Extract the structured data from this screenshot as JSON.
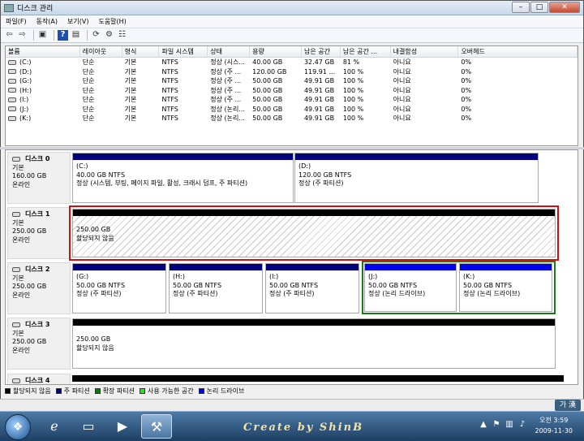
{
  "window": {
    "title": "디스크 관리"
  },
  "menu": [
    "파일(F)",
    "동작(A)",
    "보기(V)",
    "도움말(H)"
  ],
  "toolbar": {
    "icons": [
      "back-icon",
      "forward-icon",
      "console-icon",
      "help-icon",
      "show-hide-icon",
      "refresh-icon",
      "properties-icon",
      "export-icon"
    ],
    "glyphs": [
      "⇦",
      "⇨",
      "▣",
      "?",
      "▤",
      "⟳",
      "⚙",
      "☷"
    ]
  },
  "volume_list": {
    "columns": [
      "볼륨",
      "레이아웃",
      "형식",
      "파일 시스템",
      "상태",
      "용량",
      "남은 공간",
      "남은 공간 ...",
      "내결함성",
      "오버헤드"
    ],
    "rows": [
      [
        "(C:)",
        "단순",
        "기본",
        "NTFS",
        "정상 (시스...",
        "40.00 GB",
        "32.47 GB",
        "81 %",
        "아니요",
        "0%"
      ],
      [
        "(D:)",
        "단순",
        "기본",
        "NTFS",
        "정상 (주 ...",
        "120.00 GB",
        "119.91 ...",
        "100 %",
        "아니요",
        "0%"
      ],
      [
        "(G:)",
        "단순",
        "기본",
        "NTFS",
        "정상 (주 ...",
        "50.00 GB",
        "49.91 GB",
        "100 %",
        "아니요",
        "0%"
      ],
      [
        "(H:)",
        "단순",
        "기본",
        "NTFS",
        "정상 (주 ...",
        "50.00 GB",
        "49.91 GB",
        "100 %",
        "아니요",
        "0%"
      ],
      [
        "(I:)",
        "단순",
        "기본",
        "NTFS",
        "정상 (주 ...",
        "50.00 GB",
        "49.91 GB",
        "100 %",
        "아니요",
        "0%"
      ],
      [
        "(J:)",
        "단순",
        "기본",
        "NTFS",
        "정상 (논리...",
        "50.00 GB",
        "49.91 GB",
        "100 %",
        "아니요",
        "0%"
      ],
      [
        "(K:)",
        "단순",
        "기본",
        "NTFS",
        "정상 (논리...",
        "50.00 GB",
        "49.91 GB",
        "100 %",
        "아니요",
        "0%"
      ]
    ]
  },
  "disks": [
    {
      "name": "디스크 0",
      "type": "기본",
      "size": "160.00 GB",
      "status": "온라인",
      "partitions": [
        {
          "label": "(C:)",
          "size": "40.00 GB NTFS",
          "status": "정상 (시스템, 부팅, 페이지 파일, 활성, 크래시 덤프, 주 파티션)"
        },
        {
          "label": "(D:)",
          "size": "120.00 GB NTFS",
          "status": "정상 (주 파티션)"
        }
      ]
    },
    {
      "name": "디스크 1",
      "type": "기본",
      "size": "250.00 GB",
      "status": "온라인",
      "partitions": [
        {
          "label": "250.00 GB",
          "size": "할당되지 않음"
        }
      ]
    },
    {
      "name": "디스크 2",
      "type": "기본",
      "size": "250.00 GB",
      "status": "온라인",
      "partitions": [
        {
          "label": "(G:)",
          "size": "50.00 GB NTFS",
          "status": "정상 (주 파티션)"
        },
        {
          "label": "(H:)",
          "size": "50.00 GB NTFS",
          "status": "정상 (주 파티션)"
        },
        {
          "label": "(I:)",
          "size": "50.00 GB NTFS",
          "status": "정상 (주 파티션)"
        },
        {
          "label": "(J:)",
          "size": "50.00 GB NTFS",
          "status": "정상 (논리 드라이브)"
        },
        {
          "label": "(K:)",
          "size": "50.00 GB NTFS",
          "status": "정상 (논리 드라이브)"
        }
      ]
    },
    {
      "name": "디스크 3",
      "type": "기본",
      "size": "250.00 GB",
      "status": "온라인",
      "partitions": [
        {
          "label": "250.00 GB",
          "size": "할당되지 않음"
        }
      ]
    },
    {
      "name": "디스크 4"
    }
  ],
  "legend": [
    {
      "label": "할당되지 않음",
      "color": "#000000"
    },
    {
      "label": "주 파티션",
      "color": "#00007f"
    },
    {
      "label": "확장 파티션",
      "color": "#008000"
    },
    {
      "label": "사용 가능한 공간",
      "color": "#00ff00"
    },
    {
      "label": "논리 드라이브",
      "color": "#0000f0"
    }
  ],
  "language_bar": "가 漢",
  "taskbar": {
    "signature": "Create by ShinB",
    "clock_time": "오전 3:59",
    "clock_date": "2009-11-30"
  }
}
